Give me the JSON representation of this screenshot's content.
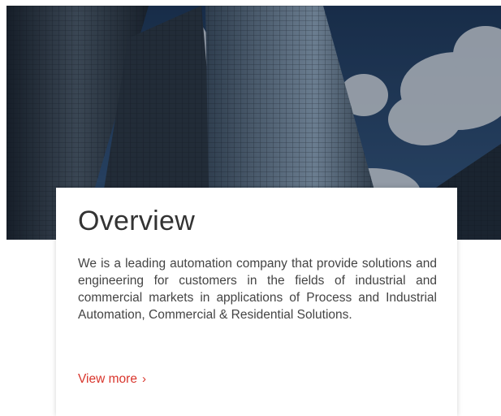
{
  "overview": {
    "title": "Overview",
    "description": "We is a leading automation company that provide solutions and engineering for customers in the fields of industrial and commercial markets in applications of Process and Industrial Automation, Commercial & Residential Solutions.",
    "link_label": "View more",
    "link_icon": "chevron-right-icon"
  },
  "colors": {
    "accent": "#d9352c",
    "title": "#333333",
    "text": "#444444"
  }
}
